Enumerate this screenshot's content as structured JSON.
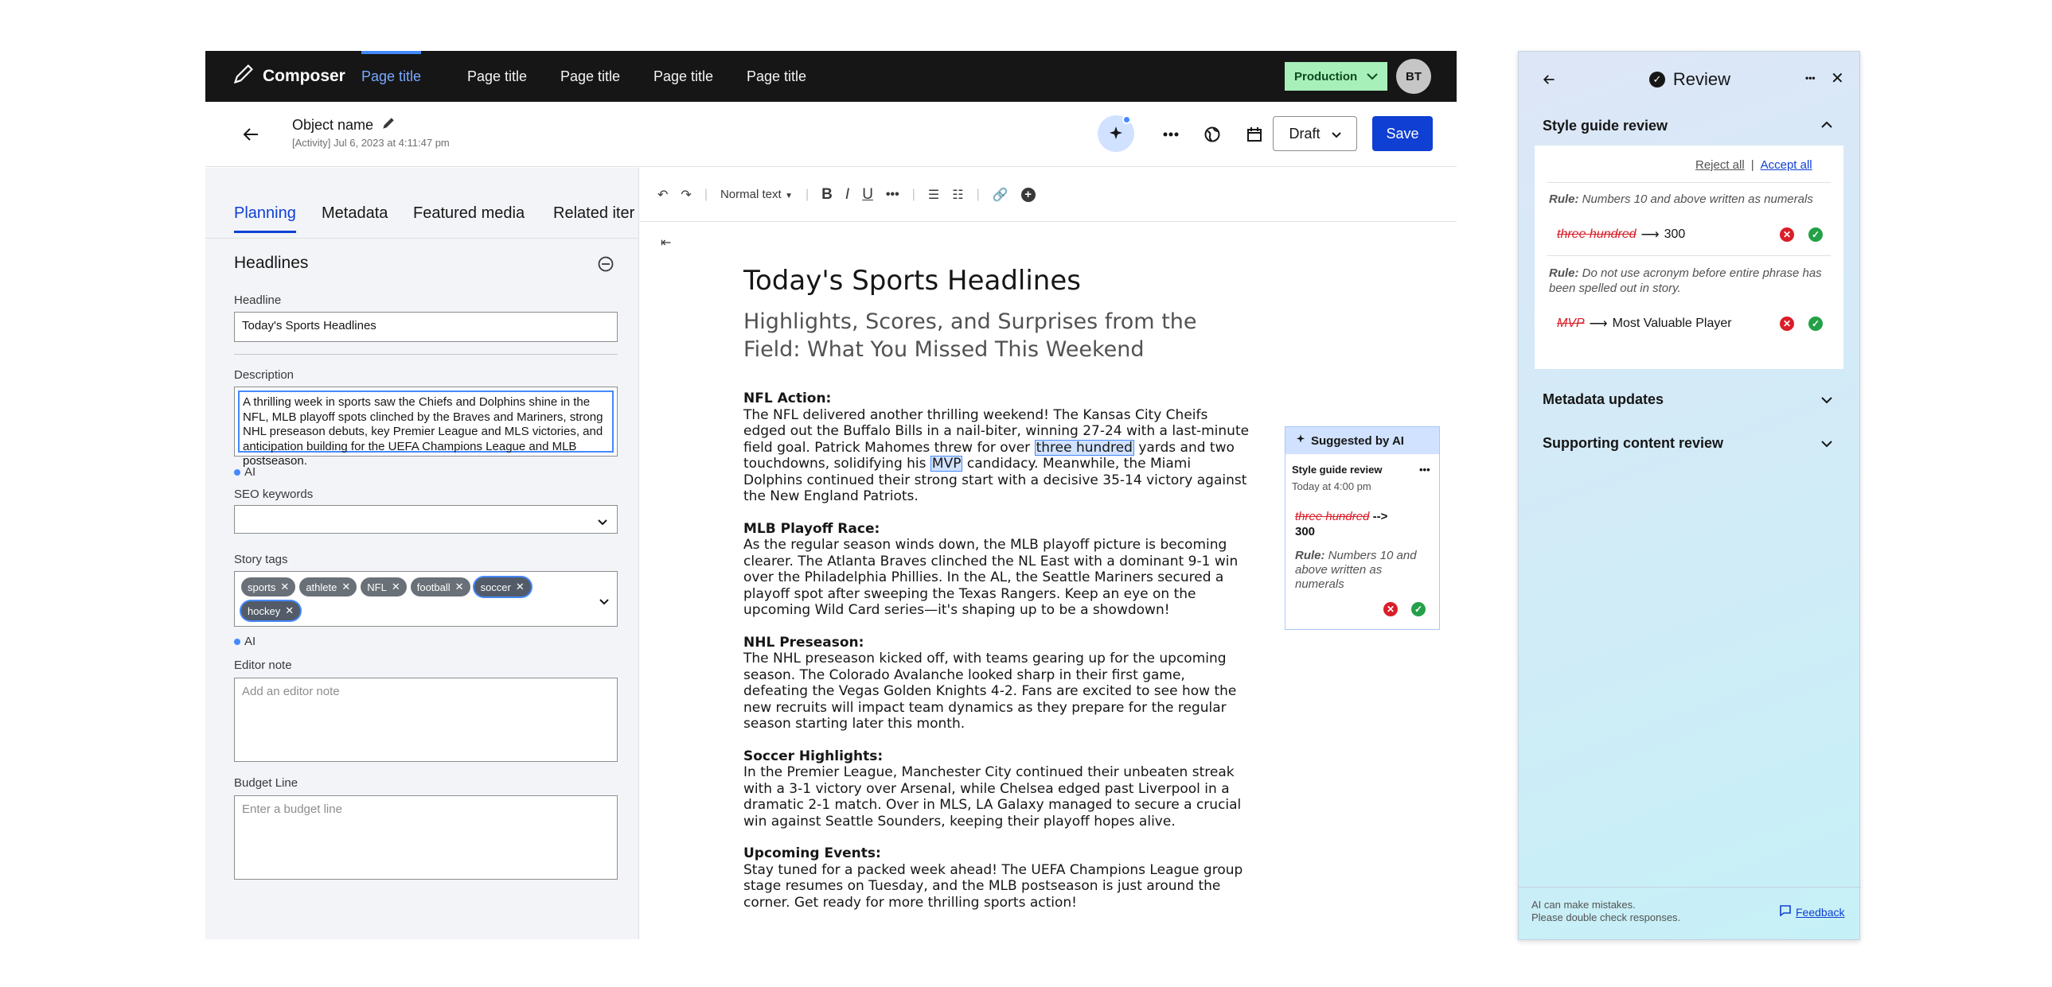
{
  "app": {
    "name": "Composer"
  },
  "top_tabs": [
    "Page title",
    "Page title",
    "Page title",
    "Page title",
    "Page title"
  ],
  "environment": "Production",
  "user_initials": "BT",
  "object": {
    "name": "Object name",
    "meta": "[Activity] Jul 6, 2023 at 4:11:47 pm"
  },
  "status": "Draft",
  "save_label": "Save",
  "left_tabs": [
    "Planning",
    "Metadata",
    "Featured media",
    "Related iter"
  ],
  "headlines_section": "Headlines",
  "fields": {
    "headline_label": "Headline",
    "headline_value": "Today's Sports Headlines",
    "description_label": "Description",
    "description_value": "A thrilling week in sports saw the Chiefs and Dolphins shine in the NFL, MLB playoff spots clinched by the Braves and Mariners, strong NHL preseason debuts, key Premier League and MLS victories, and anticipation building for the UEFA Champions League and MLB postseason.",
    "ai_label": "AI",
    "seo_label": "SEO keywords",
    "tags_label": "Story tags",
    "tags": [
      "sports",
      "athlete",
      "NFL",
      "football",
      "soccer",
      "hockey"
    ],
    "editor_note_label": "Editor note",
    "editor_note_placeholder": "Add an editor note",
    "budget_label": "Budget Line",
    "budget_placeholder": "Enter a budget line"
  },
  "toolbar": {
    "text_style": "Normal text"
  },
  "doc": {
    "title": "Today's Sports Headlines",
    "subtitle": "Highlights, Scores, and Surprises from the Field: What You Missed This Weekend",
    "p1_head": "NFL Action:",
    "p1_a": "The NFL delivered another thrilling weekend! The Kansas City Cheifs edged out the Buffalo Bills in a nail-biter, winning 27-24 with a last-minute field goal. Patrick Mahomes threw for over ",
    "p1_hl1": "three hundred",
    "p1_b": " yards and two touchdowns, solidifying his ",
    "p1_hl2": "MVP",
    "p1_c": " candidacy. Meanwhile, the Miami Dolphins continued their strong start with a decisive 35-14 victory against the New England Patriots.",
    "p2_head": "MLB Playoff Race:",
    "p2": "As the regular season winds down, the MLB playoff picture is becoming clearer. The Atlanta Braves clinched the NL East with a dominant 9-1 win over the Philadelphia Phillies. In the AL, the Seattle Mariners secured a playoff spot after sweeping the Texas Rangers. Keep an eye on the upcoming Wild Card series—it's shaping up to be a showdown!",
    "p3_head": "NHL Preseason:",
    "p3": "The NHL preseason kicked off, with teams gearing up for the upcoming season. The Colorado Avalanche looked sharp in their first game, defeating the Vegas Golden Knights 4-2. Fans are excited to see how the new recruits will impact team dynamics as they prepare for the regular season starting later this month.",
    "p4_head": "Soccer Highlights:",
    "p4": "In the Premier League, Manchester City continued their unbeaten streak with a 3-1 victory over Arsenal, while Chelsea edged past Liverpool in a dramatic 2-1 match. Over in MLS, LA Galaxy managed to secure a crucial win against Seattle Sounders, keeping their playoff hopes alive.",
    "p5_head": "Upcoming Events:",
    "p5": "Stay tuned for a packed week ahead! The UEFA Champions League group stage resumes on Tuesday, and the MLB postseason is just around the corner. Get ready for more thrilling sports action!"
  },
  "suggestion": {
    "header": "Suggested by AI",
    "title": "Style guide review",
    "time": "Today at 4:00 pm",
    "from": "three hundred",
    "arrow": "-->",
    "to": "300",
    "rule_label": "Rule:",
    "rule_text": "Numbers 10 and above written as numerals"
  },
  "review": {
    "title": "Review",
    "style_section": "Style guide review",
    "reject_all": "Reject all",
    "accept_all": "Accept all",
    "divider": "|",
    "rule_label": "Rule:",
    "rule1": "Numbers 10 and above written as numerals",
    "change1_from": "three hundred",
    "change1_to": "300",
    "rule2": "Do not use acronym before entire phrase has been spelled out in story.",
    "change2_from": "MVP",
    "change2_to": "Most Valuable Player",
    "metadata_section": "Metadata updates",
    "supporting_section": "Supporting content review",
    "footer1": "AI can make mistakes.",
    "footer2": "Please double check responses.",
    "feedback": "Feedback"
  }
}
